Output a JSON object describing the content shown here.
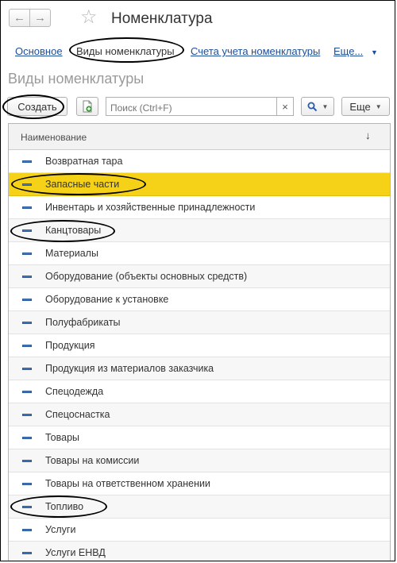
{
  "window": {
    "title": "Номенклатура",
    "back_icon": "←",
    "forward_icon": "→",
    "star_icon": "☆"
  },
  "tabs": {
    "items": [
      {
        "label": "Основное",
        "active": false
      },
      {
        "label": "Виды номенклатуры",
        "active": true
      },
      {
        "label": "Счета учета номенклатуры",
        "active": false
      },
      {
        "label": "Еще...",
        "active": false
      }
    ]
  },
  "section": {
    "title": "Виды номенклатуры"
  },
  "toolbar": {
    "create_label": "Создать",
    "search_placeholder": "Поиск (Ctrl+F)",
    "clear_icon": "×",
    "more_label": "Еще"
  },
  "table": {
    "column_name": "Наименование",
    "sort_icon": "↓",
    "rows": [
      {
        "label": "Возвратная тара"
      },
      {
        "label": "Запасные части",
        "selected": true
      },
      {
        "label": "Инвентарь и хозяйственные принадлежности"
      },
      {
        "label": "Канцтовары"
      },
      {
        "label": "Материалы"
      },
      {
        "label": "Оборудование (объекты основных средств)"
      },
      {
        "label": "Оборудование к установке"
      },
      {
        "label": "Полуфабрикаты"
      },
      {
        "label": "Продукция"
      },
      {
        "label": "Продукция из материалов заказчика"
      },
      {
        "label": "Спецодежда"
      },
      {
        "label": "Спецоснастка"
      },
      {
        "label": "Товары"
      },
      {
        "label": "Товары на комиссии"
      },
      {
        "label": "Товары на ответственном хранении"
      },
      {
        "label": "Топливо"
      },
      {
        "label": "Услуги"
      },
      {
        "label": "Услуги ЕНВД"
      }
    ]
  },
  "colors": {
    "link": "#1c4e9a",
    "selected_row": "#f5d217"
  }
}
